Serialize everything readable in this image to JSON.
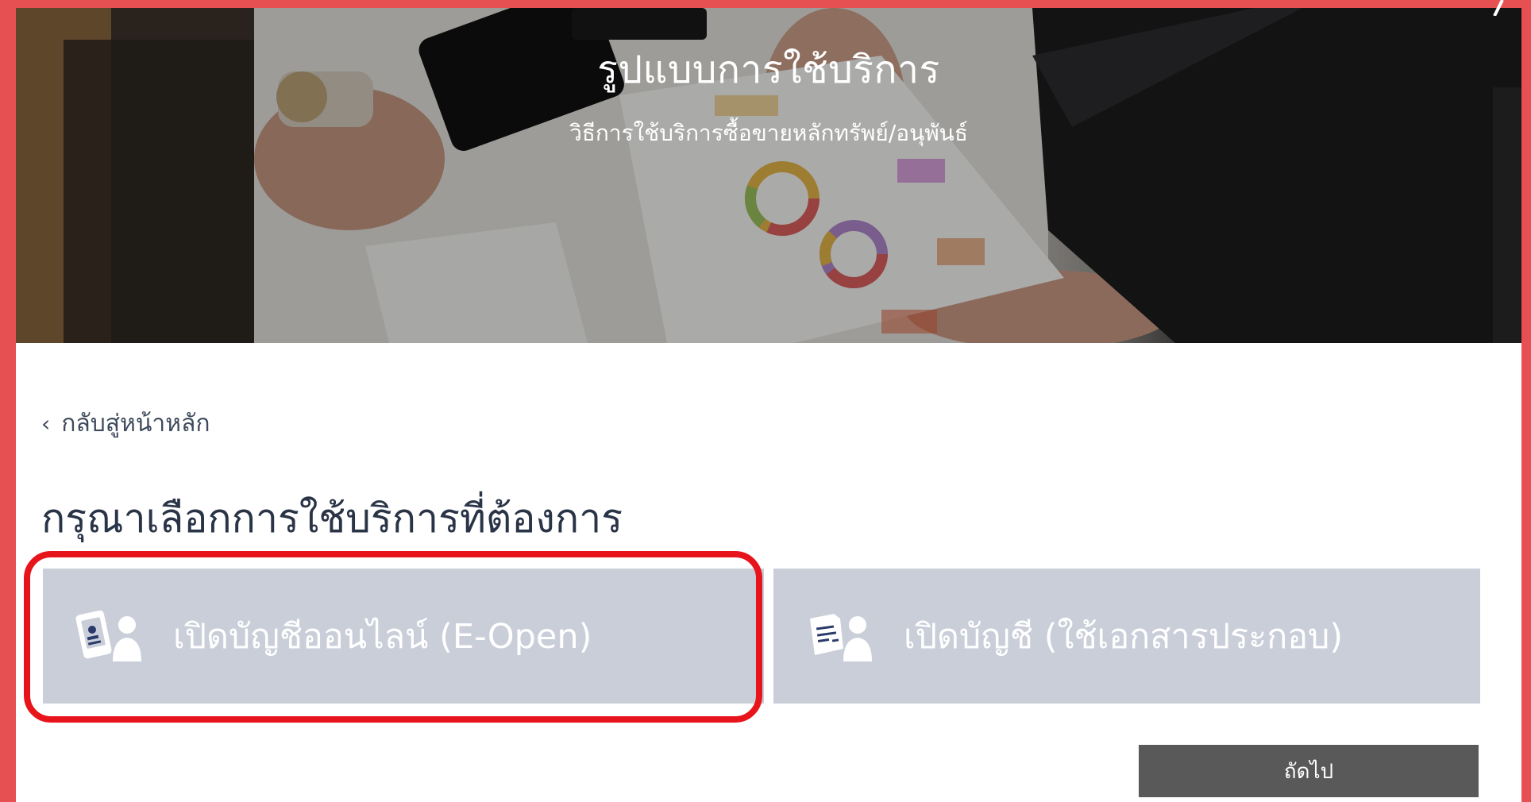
{
  "hero": {
    "title": "รูปแบบการใช้บริการ",
    "subtitle": "วิธีการใช้บริการซื้อขายหลักทรัพย์/อนุพันธ์"
  },
  "back_link": {
    "label": "กลับสู่หน้าหลัก"
  },
  "page_heading": "กรุณาเลือกการใช้บริการที่ต้องการ",
  "options": [
    {
      "label": "เปิดบัญชีออนไลน์ (E-Open)",
      "icon": "mobile-id-user-icon",
      "selected": true
    },
    {
      "label": "เปิดบัญชี (ใช้เอกสารประกอบ)",
      "icon": "document-user-icon",
      "selected": false
    }
  ],
  "next_button": {
    "label": "ถัดไป"
  },
  "colors": {
    "frame": "#e65052",
    "card": "#c9ced9",
    "highlight": "#e8141c",
    "button": "#595959",
    "heading": "#2a3447"
  }
}
